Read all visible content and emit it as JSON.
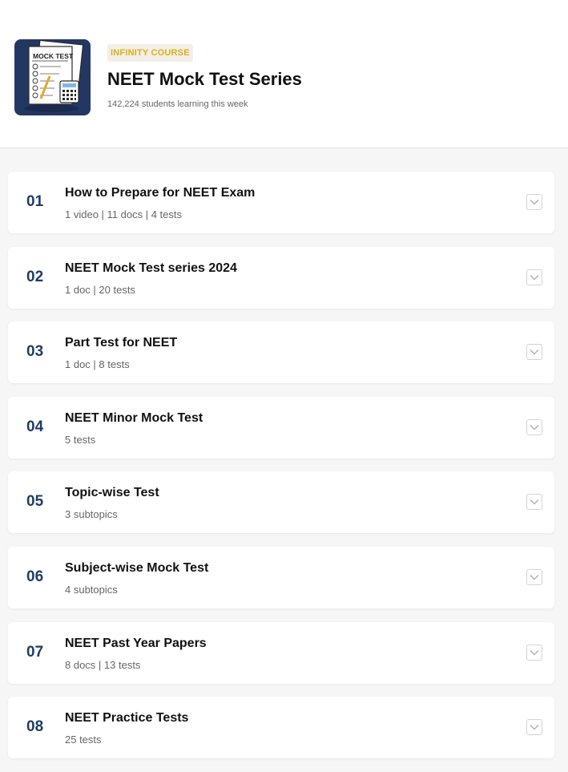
{
  "course": {
    "badge": "INFINITY COURSE",
    "title": "NEET Mock Test Series",
    "learners": "142,224 students learning this week",
    "thumbnail_text": "MOCK TEST"
  },
  "chapters": [
    {
      "number": "01",
      "title": "How to Prepare for NEET Exam",
      "meta": "1 video  | 11 docs | 4 tests"
    },
    {
      "number": "02",
      "title": "NEET Mock Test series 2024",
      "meta": "1 doc | 20 tests"
    },
    {
      "number": "03",
      "title": "Part Test for NEET",
      "meta": "1 doc | 8 tests"
    },
    {
      "number": "04",
      "title": "NEET Minor Mock Test",
      "meta": "5 tests"
    },
    {
      "number": "05",
      "title": "Topic-wise Test",
      "meta": "3 subtopics"
    },
    {
      "number": "06",
      "title": "Subject-wise Mock Test",
      "meta": "4 subtopics"
    },
    {
      "number": "07",
      "title": "NEET Past Year Papers",
      "meta": "8 docs | 13 tests"
    },
    {
      "number": "08",
      "title": "NEET Practice Tests",
      "meta": "25 tests"
    }
  ],
  "colors": {
    "badge_text": "#e0ad1c",
    "number": "#1f3d66",
    "thumbnail_bg": "#233763"
  },
  "icons": {
    "expand": "chevron-down-icon"
  }
}
